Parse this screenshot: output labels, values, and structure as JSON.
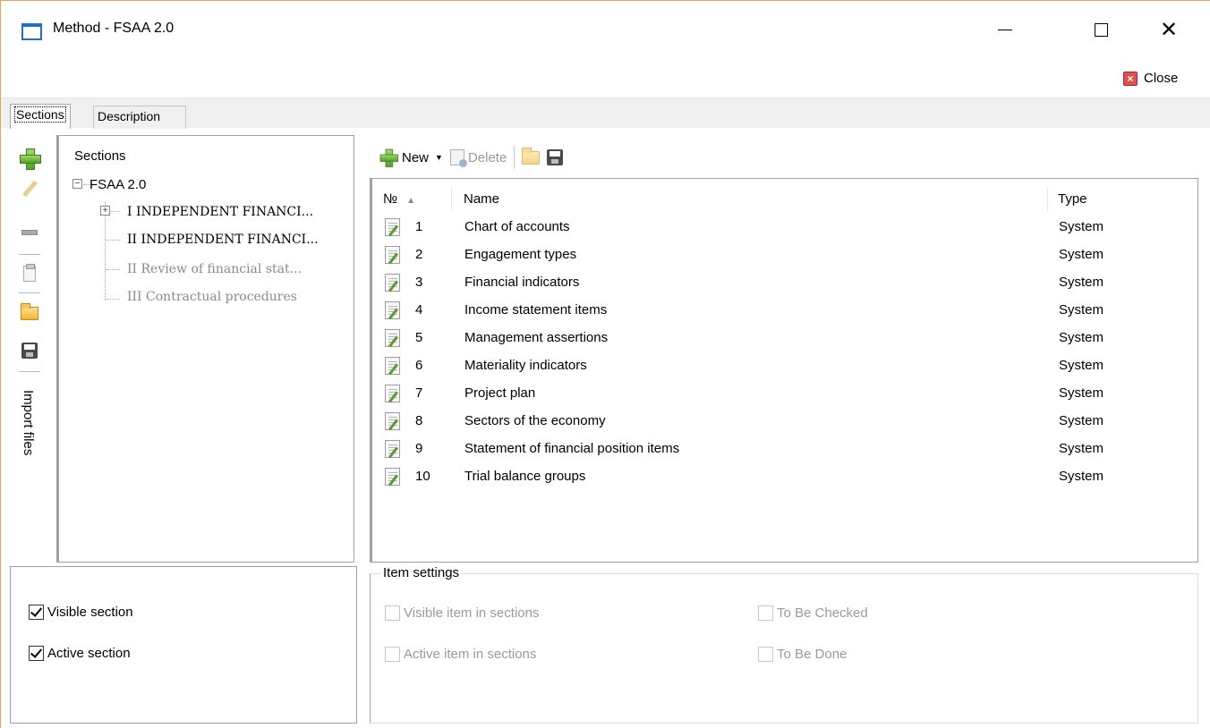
{
  "window": {
    "title": "Method - FSAA 2.0",
    "controls": {
      "minimize": "—",
      "maximize": "☐",
      "close": "✕"
    }
  },
  "actions": {
    "close_label": "Close"
  },
  "tabs": [
    {
      "label": "Sections",
      "active": true
    },
    {
      "label": "Description",
      "active": false
    }
  ],
  "left_toolbar": {
    "icons": [
      "add-icon",
      "edit-icon",
      "remove-icon",
      "paste-icon",
      "open-folder-icon",
      "save-icon"
    ],
    "vertical_label": "Import files"
  },
  "tree": {
    "header": "Sections",
    "root": "FSAA 2.0",
    "items": [
      {
        "label": "I  INDEPENDENT FINANCI...",
        "expandable": true,
        "enabled": true
      },
      {
        "label": "II  INDEPENDENT FINANCI...",
        "expandable": false,
        "enabled": true
      },
      {
        "label": "II Review of financial stat...",
        "expandable": false,
        "enabled": false
      },
      {
        "label": "III Contractual procedures",
        "expandable": false,
        "enabled": false
      }
    ]
  },
  "section_options": {
    "visible_section": {
      "label": "Visible section",
      "checked": true
    },
    "active_section": {
      "label": "Active section",
      "checked": true
    }
  },
  "right_toolbar": {
    "new_label": "New",
    "delete_label": "Delete"
  },
  "table": {
    "columns": {
      "num": "№",
      "name": "Name",
      "type": "Type"
    },
    "rows": [
      {
        "num": "1",
        "name": "Chart of accounts",
        "type": "System"
      },
      {
        "num": "2",
        "name": "Engagement types",
        "type": "System"
      },
      {
        "num": "3",
        "name": "Financial indicators",
        "type": "System"
      },
      {
        "num": "4",
        "name": "Income statement items",
        "type": "System"
      },
      {
        "num": "5",
        "name": "Management assertions",
        "type": "System"
      },
      {
        "num": "6",
        "name": "Materiality indicators",
        "type": "System"
      },
      {
        "num": "7",
        "name": "Project plan",
        "type": "System"
      },
      {
        "num": "8",
        "name": "Sectors of the economy",
        "type": "System"
      },
      {
        "num": "9",
        "name": "Statement of financial position items",
        "type": "System"
      },
      {
        "num": "10",
        "name": "Trial balance groups",
        "type": "System"
      }
    ]
  },
  "item_settings": {
    "title": "Item settings",
    "visible_in_sections": {
      "label": "Visible item in sections",
      "checked": false
    },
    "active_in_sections": {
      "label": "Active item in sections",
      "checked": false
    },
    "to_be_checked": {
      "label": "To Be Checked",
      "checked": false
    },
    "to_be_done": {
      "label": "To Be Done",
      "checked": false
    }
  }
}
